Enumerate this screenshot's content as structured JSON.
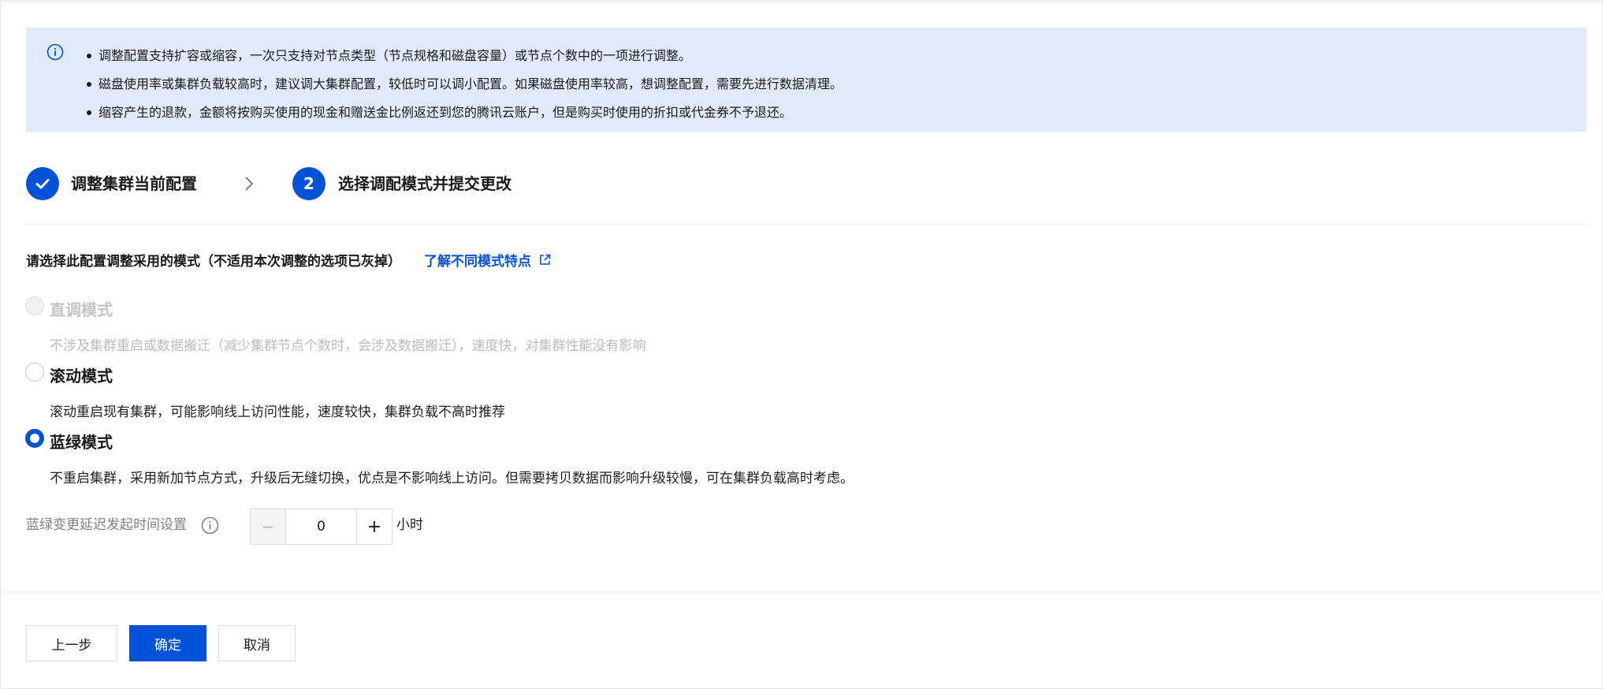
{
  "notice": {
    "items": [
      "调整配置支持扩容或缩容，一次只支持对节点类型（节点规格和磁盘容量）或节点个数中的一项进行调整。",
      "磁盘使用率或集群负载较高时，建议调大集群配置，较低时可以调小配置。如果磁盘使用率较高，想调整配置，需要先进行数据清理。",
      "缩容产生的退款，金额将按购买使用的现金和赠送金比例返还到您的腾讯云账户，但是购买时使用的折扣或代金券不予退还。"
    ]
  },
  "steps": [
    {
      "label": "调整集群当前配置",
      "status": "done"
    },
    {
      "number": "2",
      "label": "选择调配模式并提交更改",
      "status": "current"
    }
  ],
  "mode": {
    "title": "请选择此配置调整采用的模式（不适用本次调整的选项已灰掉）",
    "link": "了解不同模式特点",
    "options": [
      {
        "label": "直调模式",
        "desc": "不涉及集群重启或数据搬迁（减少集群节点个数时，会涉及数据搬迁），速度快，对集群性能没有影响",
        "state": "disabled"
      },
      {
        "label": "滚动模式",
        "desc": "滚动重启现有集群，可能影响线上访问性能，速度较快，集群负载不高时推荐",
        "state": "unchecked"
      },
      {
        "label": "蓝绿模式",
        "desc": "不重启集群，采用新加节点方式，升级后无缝切换，优点是不影响线上访问。但需要拷贝数据而影响升级较慢，可在集群负载高时考虑。",
        "state": "checked"
      }
    ]
  },
  "delay": {
    "label": "蓝绿变更延迟发起时间设置",
    "value": "0",
    "minus": "−",
    "plus": "+",
    "unit": "小时"
  },
  "footer": {
    "prev": "上一步",
    "confirm": "确定",
    "cancel": "取消"
  },
  "colors": {
    "primary": "#0052d9",
    "notice_bg": "#e1eafb"
  }
}
